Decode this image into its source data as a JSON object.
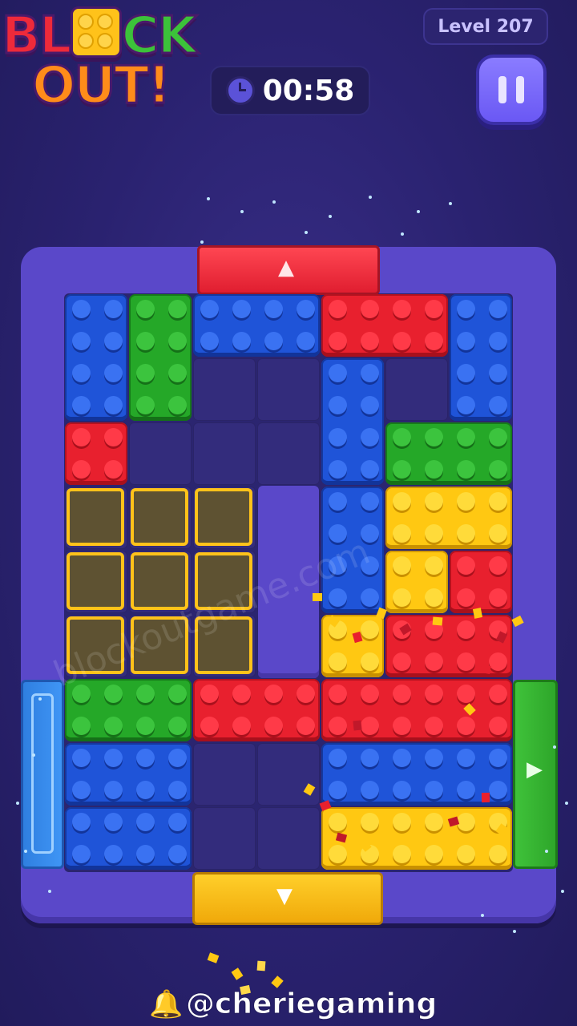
{
  "header": {
    "logo_line1": "BL",
    "logo_line1b": "CK",
    "logo_line2": "OUT!",
    "level": "Level 207",
    "timer": "00:58",
    "pause_icon": "pause-icon",
    "clock_icon": "clock-icon"
  },
  "watermark": "blockoutgame.com",
  "credit": {
    "icon": "bell-icon",
    "text": "@cheriegaming"
  },
  "colors": {
    "red": "#e8202e",
    "blue": "#1f54d8",
    "green": "#25a828",
    "yellow": "#ffc812",
    "board": "#5a48c9",
    "background": "#2a2270"
  },
  "board": {
    "cols": 7,
    "rows": 9,
    "exits": [
      {
        "side": "top",
        "color": "red",
        "cols": [
          2,
          4
        ]
      },
      {
        "side": "bottom",
        "color": "yellow",
        "cols": [
          2,
          4
        ]
      },
      {
        "side": "left",
        "color": "blue",
        "rows": [
          6,
          8
        ]
      },
      {
        "side": "right",
        "color": "green",
        "rows": [
          6,
          8
        ]
      }
    ],
    "blocks": [
      {
        "color": "blue",
        "col": 0,
        "row": 0,
        "w": 1,
        "h": 2
      },
      {
        "color": "green",
        "col": 1,
        "row": 0,
        "w": 1,
        "h": 2
      },
      {
        "color": "blue",
        "col": 2,
        "row": 0,
        "w": 2,
        "h": 1
      },
      {
        "color": "red",
        "col": 4,
        "row": 0,
        "w": 2,
        "h": 1
      },
      {
        "color": "blue",
        "col": 6,
        "row": 0,
        "w": 1,
        "h": 2
      },
      {
        "color": "blue",
        "col": 4,
        "row": 1,
        "w": 1,
        "h": 2
      },
      {
        "color": "red",
        "col": 0,
        "row": 2,
        "w": 1,
        "h": 1
      },
      {
        "color": "green",
        "col": 5,
        "row": 2,
        "w": 2,
        "h": 1
      },
      {
        "color": "blue",
        "col": 4,
        "row": 3,
        "w": 1,
        "h": 2
      },
      {
        "color": "yellow",
        "col": 5,
        "row": 3,
        "w": 2,
        "h": 1
      },
      {
        "color": "yellow",
        "col": 5,
        "row": 4,
        "w": 1,
        "h": 1
      },
      {
        "color": "red",
        "col": 6,
        "row": 4,
        "w": 1,
        "h": 1
      },
      {
        "color": "yellow",
        "col": 4,
        "row": 5,
        "w": 1,
        "h": 1
      },
      {
        "color": "red",
        "col": 5,
        "row": 5,
        "w": 2,
        "h": 1
      },
      {
        "color": "green",
        "col": 0,
        "row": 6,
        "w": 2,
        "h": 1
      },
      {
        "color": "red",
        "col": 2,
        "row": 6,
        "w": 2,
        "h": 1
      },
      {
        "color": "red",
        "col": 4,
        "row": 6,
        "w": 3,
        "h": 1
      },
      {
        "color": "blue",
        "col": 0,
        "row": 7,
        "w": 2,
        "h": 1
      },
      {
        "color": "blue",
        "col": 4,
        "row": 7,
        "w": 3,
        "h": 1
      },
      {
        "color": "blue",
        "col": 0,
        "row": 8,
        "w": 2,
        "h": 1
      },
      {
        "color": "yellow",
        "col": 4,
        "row": 8,
        "w": 3,
        "h": 1
      }
    ],
    "pillar": {
      "col": 3,
      "row": 3,
      "h": 3
    },
    "target": {
      "color": "yellow",
      "col": 0,
      "row": 3,
      "w": 3,
      "h": 3
    }
  }
}
